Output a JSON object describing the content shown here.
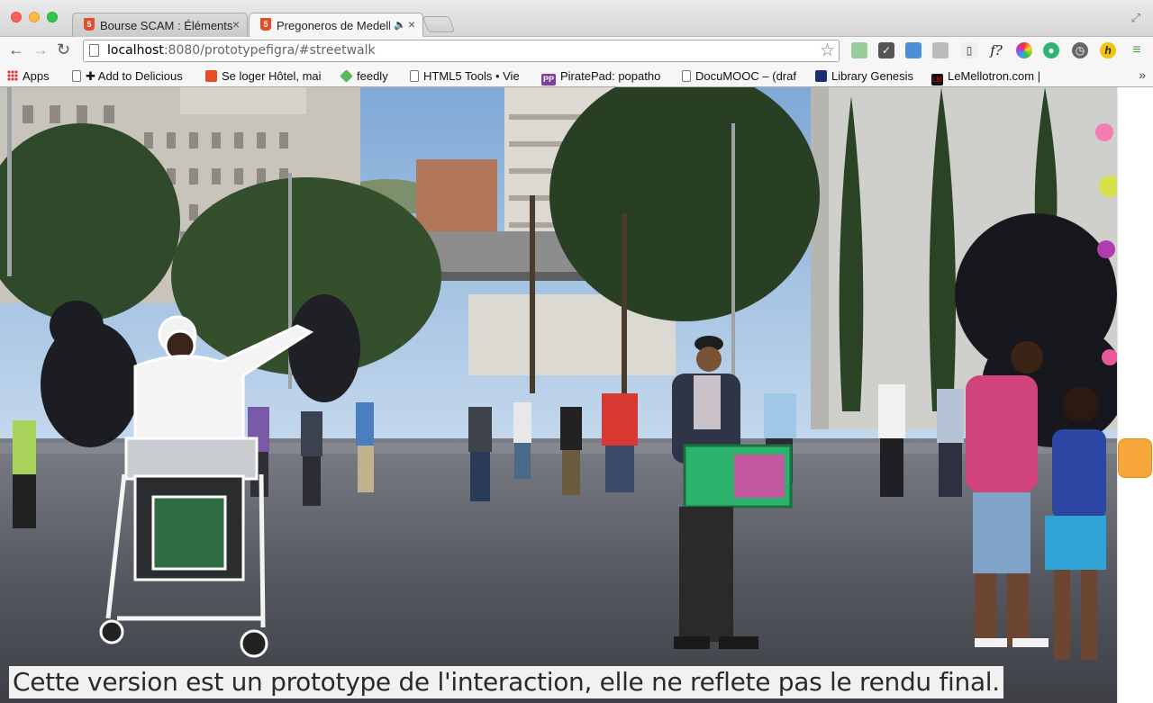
{
  "window": {
    "tabs": [
      {
        "title": "Bourse SCAM : Éléments",
        "active": false
      },
      {
        "title": "Pregoneros de Medell",
        "active": true,
        "audio": true
      }
    ]
  },
  "toolbar": {
    "url_host": "localhost",
    "url_rest": ":8080/prototypefigra/#streetwalk"
  },
  "bookmarks": [
    {
      "label": "Apps",
      "icon": "apps-grid-icon"
    },
    {
      "label": "✚ Add to Delicious",
      "icon": "page-icon"
    },
    {
      "label": "Se loger Hôtel, mai",
      "icon": "html5-icon"
    },
    {
      "label": "feedly",
      "icon": "feedly-icon"
    },
    {
      "label": "HTML5 Tools • Vie",
      "icon": "page-icon"
    },
    {
      "label": "PiratePad: popatho",
      "icon": "piratepad-icon"
    },
    {
      "label": "DocuMOOC – (draf",
      "icon": "page-icon"
    },
    {
      "label": "Library Genesis",
      "icon": "library-icon"
    },
    {
      "label": "LeMellotron.com |",
      "icon": "lemellotron-icon"
    }
  ],
  "content": {
    "caption": "Cette version est un prototype de l'interaction, elle ne reflete pas le rendu final."
  },
  "colors": {
    "accent_handle": "#f7a73a",
    "sky": "#9fc3e6"
  }
}
